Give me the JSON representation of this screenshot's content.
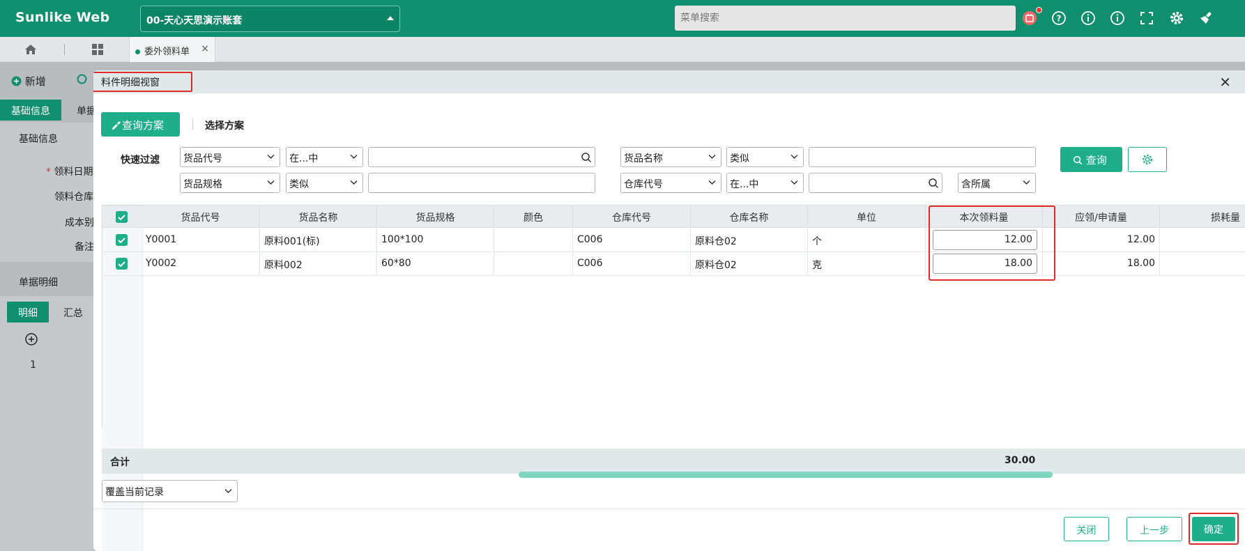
{
  "app": {
    "brand": "Sunlike Web",
    "account": "00-天心天思演示账套",
    "menu_search_placeholder": "菜单搜索",
    "icons": [
      "notification-icon",
      "help-icon",
      "info-icon",
      "about-icon",
      "fullscreen-icon",
      "settings-icon",
      "clean-icon"
    ]
  },
  "tabs": {
    "active": "委外领料单"
  },
  "background": {
    "toolbar": {
      "new_label": "新增"
    },
    "section_tabs": [
      "基础信息",
      "单据"
    ],
    "section_title": "基础信息",
    "fields": [
      "领料日期",
      "领料仓库",
      "成本别",
      "备注"
    ],
    "detail_title": "单据明细",
    "detail_tabs": [
      "明细",
      "汇总"
    ],
    "row_number": "1"
  },
  "modal": {
    "title": "料件明细视窗",
    "query_scheme_button": "查询方案",
    "select_scheme_label": "选择方案",
    "quick_filter_label": "快速过滤",
    "filters": {
      "row1": [
        {
          "field": "货品代号",
          "op": "在...中",
          "value": ""
        },
        {
          "field": "货品名称",
          "op": "类似",
          "value": ""
        }
      ],
      "row2": [
        {
          "field": "货品规格",
          "op": "类似",
          "value": ""
        },
        {
          "field": "仓库代号",
          "op": "在...中",
          "value": "",
          "scope": "含所属"
        }
      ]
    },
    "search_button": "查询",
    "table": {
      "columns": [
        "货品代号",
        "货品名称",
        "货品规格",
        "颜色",
        "仓库代号",
        "仓库名称",
        "单位",
        "本次领料量",
        "应领/申请量",
        "损耗量"
      ],
      "rows": [
        {
          "code": "Y0001",
          "name": "原料001(标)",
          "spec": "100*100",
          "color": "",
          "wh_code": "C006",
          "wh_name": "原料仓02",
          "unit": "个",
          "qty": "12.00",
          "req_qty": "12.00",
          "loss": ""
        },
        {
          "code": "Y0002",
          "name": "原料002",
          "spec": "60*80",
          "color": "",
          "wh_code": "C006",
          "wh_name": "原料仓02",
          "unit": "克",
          "qty": "18.00",
          "req_qty": "18.00",
          "loss": ""
        }
      ],
      "sum_label": "合计",
      "sum_qty": "30.00"
    },
    "mode_select": "覆盖当前记录",
    "buttons": {
      "close": "关闭",
      "prev": "上一步",
      "ok": "确定"
    }
  }
}
